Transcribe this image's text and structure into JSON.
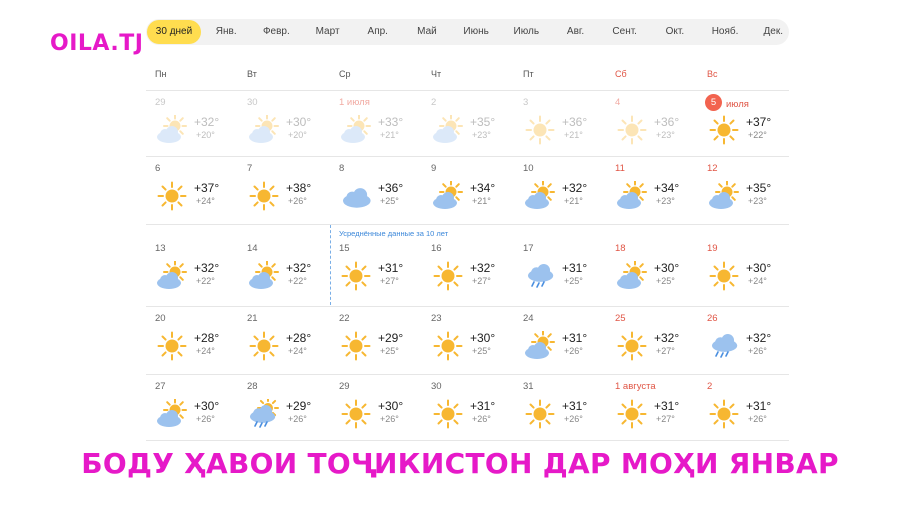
{
  "logo": "OILA.TJ",
  "months": [
    {
      "label": "30 дней",
      "active": true
    },
    {
      "label": "Янв."
    },
    {
      "label": "Февр."
    },
    {
      "label": "Март"
    },
    {
      "label": "Апр."
    },
    {
      "label": "Май"
    },
    {
      "label": "Июнь"
    },
    {
      "label": "Июль"
    },
    {
      "label": "Авг."
    },
    {
      "label": "Сент."
    },
    {
      "label": "Окт."
    },
    {
      "label": "Нояб."
    },
    {
      "label": "Дек."
    }
  ],
  "weekdays": [
    {
      "label": "Пн"
    },
    {
      "label": "Вт"
    },
    {
      "label": "Ср"
    },
    {
      "label": "Чт"
    },
    {
      "label": "Пт"
    },
    {
      "label": "Сб",
      "weekend": true
    },
    {
      "label": "Вс",
      "weekend": true
    }
  ],
  "average_note": "Усреднённые данные за 10 лет",
  "caption": "БОДУ ҲАВОИ ТОҶИКИСТОН ДАР МОҲИ ЯНВАР",
  "colors": {
    "accent_yellow": "#ffdd4f",
    "brand_magenta": "#e619c8",
    "weekend_red": "#e05545",
    "today_badge": "#f2634f",
    "sun": "#f7b731",
    "cloud": "#9cc2ee",
    "rain": "#4a8fe0",
    "note_blue": "#3b87d9"
  },
  "days": [
    {
      "date": "29",
      "icon": "partly-cloudy-icon",
      "max": "+32°",
      "min": "+20°",
      "past": true
    },
    {
      "date": "30",
      "icon": "partly-cloudy-icon",
      "max": "+30°",
      "min": "+20°",
      "past": true
    },
    {
      "date": "1 июля",
      "icon": "partly-cloudy-icon",
      "max": "+33°",
      "min": "+21°",
      "past": true,
      "red": true
    },
    {
      "date": "2",
      "icon": "partly-cloudy-icon",
      "max": "+35°",
      "min": "+23°",
      "past": true
    },
    {
      "date": "3",
      "icon": "sun-icon",
      "max": "+36°",
      "min": "+21°",
      "past": true
    },
    {
      "date": "4",
      "icon": "sun-icon",
      "max": "+36°",
      "min": "+23°",
      "past": true
    },
    {
      "date": "5",
      "date_extra": "июля",
      "today": true,
      "icon": "sun-icon",
      "max": "+37°",
      "min": "+22°"
    },
    {
      "date": "6",
      "icon": "sun-icon",
      "max": "+37°",
      "min": "+24°"
    },
    {
      "date": "7",
      "icon": "sun-icon",
      "max": "+38°",
      "min": "+26°"
    },
    {
      "date": "8",
      "icon": "cloudy-icon",
      "max": "+36°",
      "min": "+25°"
    },
    {
      "date": "9",
      "icon": "partly-cloudy-icon",
      "max": "+34°",
      "min": "+21°"
    },
    {
      "date": "10",
      "icon": "partly-cloudy-icon",
      "max": "+32°",
      "min": "+21°"
    },
    {
      "date": "11",
      "icon": "partly-cloudy-icon",
      "max": "+34°",
      "min": "+23°"
    },
    {
      "date": "12",
      "icon": "partly-cloudy-icon",
      "max": "+35°",
      "min": "+23°"
    },
    {
      "date": "13",
      "icon": "partly-cloudy-icon",
      "max": "+32°",
      "min": "+22°"
    },
    {
      "date": "14",
      "icon": "partly-cloudy-icon",
      "max": "+32°",
      "min": "+22°"
    },
    {
      "date": "15",
      "icon": "sun-icon",
      "max": "+31°",
      "min": "+27°"
    },
    {
      "date": "16",
      "icon": "sun-icon",
      "max": "+32°",
      "min": "+27°"
    },
    {
      "date": "17",
      "icon": "cloud-rain-icon",
      "max": "+31°",
      "min": "+25°"
    },
    {
      "date": "18",
      "icon": "partly-cloudy-icon",
      "max": "+30°",
      "min": "+25°"
    },
    {
      "date": "19",
      "icon": "sun-icon",
      "max": "+30°",
      "min": "+24°"
    },
    {
      "date": "20",
      "icon": "sun-icon",
      "max": "+28°",
      "min": "+24°"
    },
    {
      "date": "21",
      "icon": "sun-icon",
      "max": "+28°",
      "min": "+24°"
    },
    {
      "date": "22",
      "icon": "sun-icon",
      "max": "+29°",
      "min": "+25°"
    },
    {
      "date": "23",
      "icon": "sun-icon",
      "max": "+30°",
      "min": "+25°"
    },
    {
      "date": "24",
      "icon": "partly-cloudy-icon",
      "max": "+31°",
      "min": "+26°"
    },
    {
      "date": "25",
      "icon": "sun-icon",
      "max": "+32°",
      "min": "+27°"
    },
    {
      "date": "26",
      "icon": "cloud-rain-icon",
      "max": "+32°",
      "min": "+26°"
    },
    {
      "date": "27",
      "icon": "partly-cloudy-icon",
      "max": "+30°",
      "min": "+26°"
    },
    {
      "date": "28",
      "icon": "sun-rain-icon",
      "max": "+29°",
      "min": "+26°"
    },
    {
      "date": "29",
      "icon": "sun-icon",
      "max": "+30°",
      "min": "+26°"
    },
    {
      "date": "30",
      "icon": "sun-icon",
      "max": "+31°",
      "min": "+26°"
    },
    {
      "date": "31",
      "icon": "sun-icon",
      "max": "+31°",
      "min": "+26°"
    },
    {
      "date": "1 августа",
      "icon": "sun-icon",
      "max": "+31°",
      "min": "+27°"
    },
    {
      "date": "2",
      "icon": "sun-icon",
      "max": "+31°",
      "min": "+26°"
    }
  ]
}
